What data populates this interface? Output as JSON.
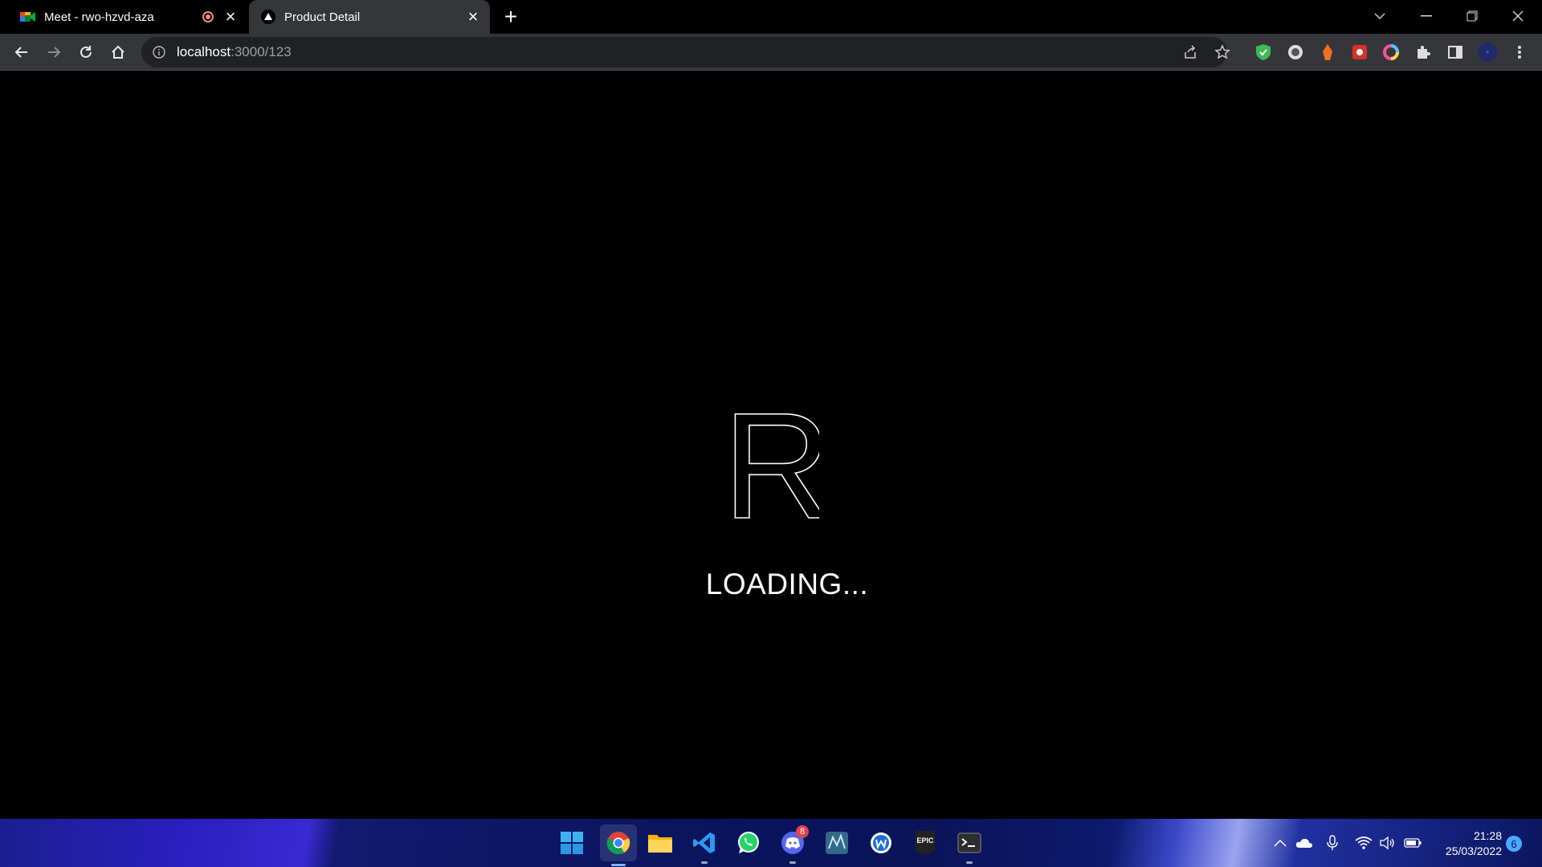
{
  "browser": {
    "tabs": [
      {
        "title": "Meet - rwo-hzvd-aza",
        "favicon": "google-meet-icon",
        "recording": true
      },
      {
        "title": "Product Detail",
        "favicon": "nextjs-triangle-icon",
        "active": true
      }
    ],
    "url": {
      "host": "localhost",
      "path": ":3000/123"
    }
  },
  "page": {
    "logo_letter": "R",
    "loading_text": "LOADING..."
  },
  "taskbar": {
    "apps": [
      "windows-start-icon",
      "chrome-icon",
      "file-explorer-icon",
      "vscode-icon",
      "whatsapp-icon",
      "discord-icon",
      "mysql-workbench-icon",
      "app-w-icon",
      "epic-games-icon",
      "terminal-icon"
    ],
    "discord_badge": "8",
    "epic_label": "EPIC",
    "clock": {
      "time": "21:28",
      "date": "25/03/2022"
    },
    "notifications": "6"
  },
  "colors": {
    "page_bg": "#000000",
    "tab_active": "#35363a",
    "omnibox": "#202124"
  }
}
